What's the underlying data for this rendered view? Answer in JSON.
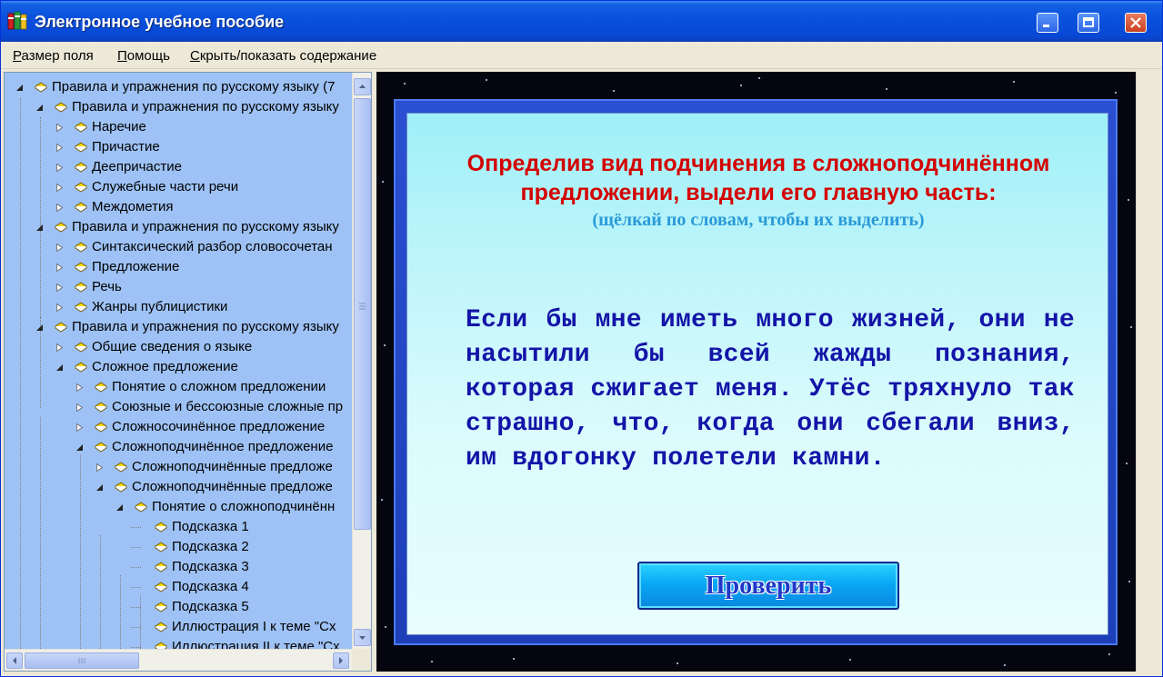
{
  "window": {
    "title": "Электронное учебное пособие"
  },
  "menu": {
    "items": [
      {
        "label": "Размер поля",
        "accel": "Р",
        "rest": "азмер поля"
      },
      {
        "label": "Помощь",
        "accel": "П",
        "rest": "омощь"
      },
      {
        "label": "Скрыть/показать содержание",
        "accel": "С",
        "rest": "крыть/показать содержание"
      }
    ]
  },
  "tree": {
    "items": [
      {
        "label": "Правила и упражнения по русскому языку (7"
      },
      {
        "label": "Правила и упражнения по русскому языку"
      },
      {
        "label": "Наречие"
      },
      {
        "label": "Причастие"
      },
      {
        "label": "Деепричастие"
      },
      {
        "label": "Служебные части речи"
      },
      {
        "label": "Междометия"
      },
      {
        "label": "Правила и упражнения по русскому языку"
      },
      {
        "label": "Синтаксический разбор словосочетан"
      },
      {
        "label": "Предложение"
      },
      {
        "label": "Речь"
      },
      {
        "label": "Жанры публицистики"
      },
      {
        "label": "Правила и упражнения по русскому языку"
      },
      {
        "label": "Общие сведения о языке"
      },
      {
        "label": "Сложное предложение"
      },
      {
        "label": "Понятие о сложном предложении"
      },
      {
        "label": "Союзные и бессоюзные сложные пр"
      },
      {
        "label": "Сложносочинённое предложение"
      },
      {
        "label": "Сложноподчинённое предложение"
      },
      {
        "label": "Сложноподчинённые предложе"
      },
      {
        "label": "Сложноподчинённые предложе"
      },
      {
        "label": "Понятие о сложноподчинённ"
      },
      {
        "label": "Подсказка 1"
      },
      {
        "label": "Подсказка 2"
      },
      {
        "label": "Подсказка 3"
      },
      {
        "label": "Подсказка 4"
      },
      {
        "label": "Подсказка 5"
      },
      {
        "label": "Иллюстрация I к теме \"Сх"
      },
      {
        "label": "Иллюстрация II к теме \"Сх"
      }
    ]
  },
  "exercise": {
    "title_line1": "Определив вид подчинения в сложноподчинённом",
    "title_line2": "предложении, выдели его главную часть:",
    "hint": "(щёлкай по словам, чтобы их выделить)",
    "text": "Если бы мне иметь много жизней, они не насытили бы всей жажды познания, которая сжигает меня. Утёс тряхнуло так страшно, что, когда они сбегали вниз, им вдогонку полетели камни.",
    "check_label": "Проверить"
  },
  "colors": {
    "title_red": "#d40000",
    "hint_blue": "#2a9ad8",
    "text_navy": "#1414a8",
    "tree_bg": "#9ec2f5"
  }
}
